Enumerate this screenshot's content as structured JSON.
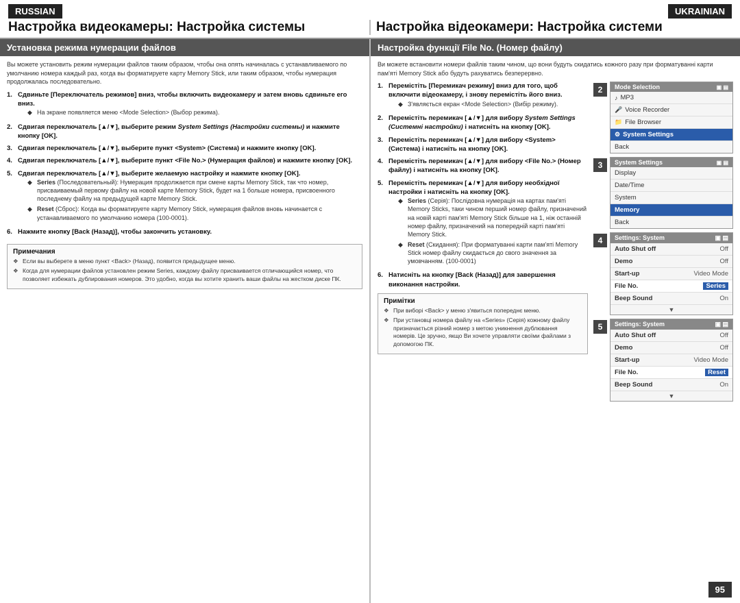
{
  "lang_left": "RUSSIAN",
  "lang_right": "UKRAINIAN",
  "title_left": "Настройка видеокамеры: Настройка системы",
  "title_right": "Настройка відеокамери: Настройка системи",
  "section_left": "Установка режима нумерации файлов",
  "section_right": "Настройка функції File No. (Номер файлу)",
  "intro_left": "Вы можете установить режим нумерации файлов таким образом, чтобы она опять начиналась с устанавливаемого по умолчанию номера каждый раз, когда вы форматируете карту Memory Stick, или таким образом, чтобы нумерация продолжалась последовательно.",
  "intro_right": "Ви можете встановити номери файлів таким чином, що вони будуть скидатись кожного разу при форматуванні карти пам'яті Memory Stick або будуть рахуватись безперервно.",
  "steps_left": [
    {
      "num": "1.",
      "text": "Сдвиньте [Переключатель режимов] вниз, чтобы включить видеокамеру и затем вновь сдвиньте его вниз.",
      "bullets": [
        "На экране появляется меню <Mode Selection> (Выбор режима)."
      ]
    },
    {
      "num": "2.",
      "text_before": "Сдвигая переключатель [▲/▼], выберите режим ",
      "text_italic": "System Settings (Настройки системы)",
      "text_after": " и нажмите кнопку [OK]."
    },
    {
      "num": "3.",
      "text": "Сдвигая переключатель [▲/▼], выберите пункт <System> (Система) и нажмите кнопку [OK]."
    },
    {
      "num": "4.",
      "text": "Сдвигая переключатель [▲/▼], выберите пункт <File No.> (Нумерация файлов) и нажмите кнопку [OK]."
    },
    {
      "num": "5.",
      "text": "Сдвигая переключатель [▲/▼], выберите желаемую настройку и нажмите кнопку [OK].",
      "bullets_special": [
        {
          "title": "Series",
          "text": " (Последовательный): Нумерация продолжается при смене карты Memory Stick, так что номер, присваиваемый первому файлу на новой карте Memory Stick, будет на 1 больше номера, присвоенного последнему файлу на предыдущей карте Memory Stick."
        },
        {
          "title": "Reset",
          "text": " (Сброс): Когда вы форматируете карту Memory Stick, нумерация файлов вновь начинается с устанавливаемого по умолчанию номера (100-0001)."
        }
      ]
    },
    {
      "num": "6.",
      "text": "Нажмите кнопку [Back (Назад)], чтобы закончить установку."
    }
  ],
  "notes_left_title": "Примечания",
  "notes_left": [
    "Если вы выберете в меню пункт <Back> (Назад), появится предыдущее меню.",
    "Когда для нумерации файлов установлен режим Series, каждому файлу присваивается отличающийся номер, что позволяет избежать дублирования номеров. Это удобно, когда вы хотите хранить ваши файлы на жестком диске ПК."
  ],
  "steps_right": [
    {
      "num": "1.",
      "text": "Перемістіть [Перемикач режиму] вниз для того, щоб включити відеокамеру, і знову перемістіть його вниз.",
      "bullets": [
        "З'являється екран <Mode Selection> (Вибір режиму)."
      ]
    },
    {
      "num": "2.",
      "text_before": "Перемістіть перемикач [▲/▼] для вибору ",
      "text_italic": "System Settings (Системні настройки)",
      "text_after": " і натисніть на кнопку [OK]."
    },
    {
      "num": "3.",
      "text": "Перемістіть перемикач [▲/▼] для вибору <System> (Система) і натисніть на кнопку [OK]."
    },
    {
      "num": "4.",
      "text": "Перемістіть перемикач [▲/▼] для вибору <File No.> (Номер файлу) і натисніть на кнопку [OK]."
    },
    {
      "num": "5.",
      "text": "Перемістіть перемикач [▲/▼] для вибору необхідної настройки і натисніть на кнопку [OK].",
      "bullets_special": [
        {
          "title": "Series",
          "sub": "(Серія):",
          "text": " Послідовна нумерація на картах пам'яті Memory Sticks, таки чином перший номер файлу, призначений на новій карті пам'яті Memory Stick більше на 1, ніж останній номер файлу, призначений на попередній карті пам'яті Memory Stick."
        },
        {
          "title": "Reset",
          "sub": "(Скидання):",
          "text": " При форматуванні карти пам'яті Memory Stick номер файлу скидається до свого значення за умовчанням. (100-0001)"
        }
      ]
    },
    {
      "num": "6.",
      "text": "Натисніть на кнопку [Back (Назад)] для завершення виконання настройки."
    }
  ],
  "notes_right_title": "Примітки",
  "notes_right": [
    "При виборі <Back> у меню з'явиться попереднє меню.",
    "При установці номера файлу на «Series» (Серія) кожному файлу призначається різний номер з метою уникнення дублювання номерів. Це зручно, якщо Ви хочете управляти своїми файлами з допомогою ПК."
  ],
  "menu1": {
    "title": "Mode Selection",
    "items": [
      {
        "icon": "♪",
        "label": "MP3",
        "selected": false
      },
      {
        "icon": "🎤",
        "label": "Voice Recorder",
        "selected": false
      },
      {
        "icon": "📁",
        "label": "File Browser",
        "selected": false
      },
      {
        "icon": "⚙",
        "label": "System Settings",
        "selected": true
      },
      {
        "icon": "",
        "label": "Back",
        "selected": false
      }
    ]
  },
  "menu2": {
    "title": "System Settings",
    "items": [
      {
        "label": "Display",
        "selected": false
      },
      {
        "label": "Date/Time",
        "selected": false
      },
      {
        "label": "System",
        "selected": false
      },
      {
        "label": "Memory",
        "selected": true
      },
      {
        "label": "Back",
        "selected": false
      }
    ]
  },
  "menu3": {
    "title": "Settings: System",
    "rows": [
      {
        "label": "Auto Shut off",
        "value": "Off"
      },
      {
        "label": "Demo",
        "value": "Off"
      },
      {
        "label": "Start-up",
        "value": "Video Mode"
      },
      {
        "label": "File No.",
        "value": "Series",
        "highlight": true
      },
      {
        "label": "Beep Sound",
        "value": "On"
      }
    ]
  },
  "menu4": {
    "title": "Settings: System",
    "rows": [
      {
        "label": "Auto Shut off",
        "value": "Off"
      },
      {
        "label": "Demo",
        "value": "Off"
      },
      {
        "label": "Start-up",
        "value": "Video Mode"
      },
      {
        "label": "File No.",
        "value": "Reset",
        "highlight": true
      },
      {
        "label": "Beep Sound",
        "value": "On"
      }
    ]
  },
  "page_num": "95",
  "step_labels": {
    "two": "2",
    "three": "3",
    "four": "4",
    "five": "5"
  }
}
